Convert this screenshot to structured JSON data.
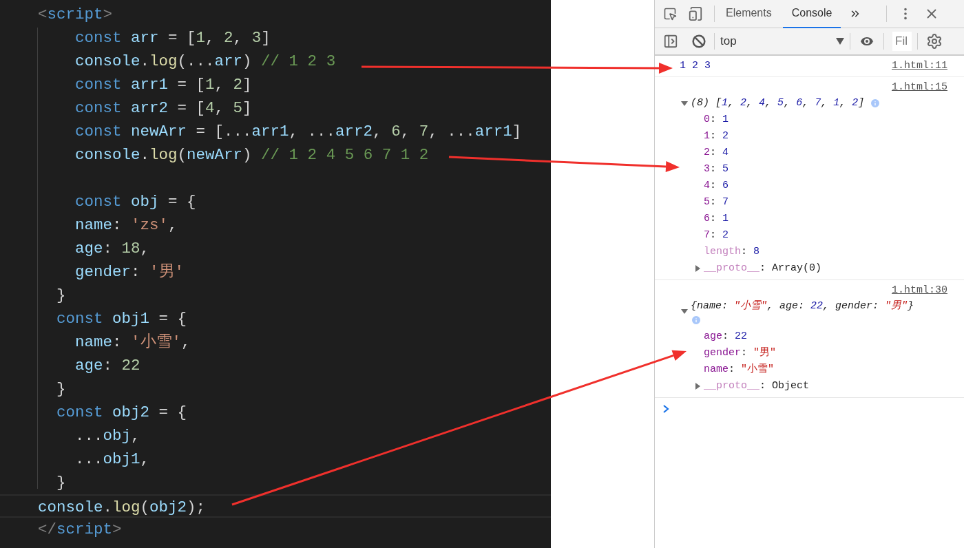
{
  "editor": {
    "lines": [
      {
        "current": false,
        "tokens": [
          {
            "kind": "bracket",
            "text": "<"
          },
          {
            "kind": "tag",
            "text": "script"
          },
          {
            "kind": "bracket",
            "text": ">"
          }
        ]
      },
      {
        "current": false,
        "tokens": [
          {
            "kind": "keyword",
            "text": "    const"
          },
          {
            "kind": "variable",
            "text": " arr"
          },
          {
            "kind": "plain",
            "text": " = ["
          },
          {
            "kind": "number",
            "text": "1"
          },
          {
            "kind": "plain",
            "text": ", "
          },
          {
            "kind": "number",
            "text": "2"
          },
          {
            "kind": "plain",
            "text": ", "
          },
          {
            "kind": "number",
            "text": "3"
          },
          {
            "kind": "plain",
            "text": "]"
          }
        ]
      },
      {
        "current": false,
        "tokens": [
          {
            "kind": "variable",
            "text": "    console"
          },
          {
            "kind": "plain",
            "text": "."
          },
          {
            "kind": "function",
            "text": "log"
          },
          {
            "kind": "plain",
            "text": "(..."
          },
          {
            "kind": "variable",
            "text": "arr"
          },
          {
            "kind": "plain",
            "text": ")"
          },
          {
            "kind": "comment",
            "text": " // 1 2 3"
          }
        ]
      },
      {
        "current": false,
        "tokens": [
          {
            "kind": "keyword",
            "text": "    const"
          },
          {
            "kind": "variable",
            "text": " arr1"
          },
          {
            "kind": "plain",
            "text": " = ["
          },
          {
            "kind": "number",
            "text": "1"
          },
          {
            "kind": "plain",
            "text": ", "
          },
          {
            "kind": "number",
            "text": "2"
          },
          {
            "kind": "plain",
            "text": "]"
          }
        ]
      },
      {
        "current": false,
        "tokens": [
          {
            "kind": "keyword",
            "text": "    const"
          },
          {
            "kind": "variable",
            "text": " arr2"
          },
          {
            "kind": "plain",
            "text": " = ["
          },
          {
            "kind": "number",
            "text": "4"
          },
          {
            "kind": "plain",
            "text": ", "
          },
          {
            "kind": "number",
            "text": "5"
          },
          {
            "kind": "plain",
            "text": "]"
          }
        ]
      },
      {
        "current": false,
        "tokens": [
          {
            "kind": "keyword",
            "text": "    const"
          },
          {
            "kind": "variable",
            "text": " newArr"
          },
          {
            "kind": "plain",
            "text": " = [..."
          },
          {
            "kind": "variable",
            "text": "arr1"
          },
          {
            "kind": "plain",
            "text": ", ..."
          },
          {
            "kind": "variable",
            "text": "arr2"
          },
          {
            "kind": "plain",
            "text": ", "
          },
          {
            "kind": "number",
            "text": "6"
          },
          {
            "kind": "plain",
            "text": ", "
          },
          {
            "kind": "number",
            "text": "7"
          },
          {
            "kind": "plain",
            "text": ", ..."
          },
          {
            "kind": "variable",
            "text": "arr1"
          },
          {
            "kind": "plain",
            "text": "]"
          }
        ]
      },
      {
        "current": false,
        "tokens": [
          {
            "kind": "variable",
            "text": "    console"
          },
          {
            "kind": "plain",
            "text": "."
          },
          {
            "kind": "function",
            "text": "log"
          },
          {
            "kind": "plain",
            "text": "("
          },
          {
            "kind": "variable",
            "text": "newArr"
          },
          {
            "kind": "plain",
            "text": ")"
          },
          {
            "kind": "comment",
            "text": " // 1 2 4 5 6 7 1 2"
          }
        ]
      },
      {
        "current": false
      },
      {
        "current": false,
        "tokens": [
          {
            "kind": "keyword",
            "text": "    const"
          },
          {
            "kind": "variable",
            "text": " obj"
          },
          {
            "kind": "plain",
            "text": " = {"
          }
        ]
      },
      {
        "current": false,
        "tokens": [
          {
            "kind": "variable",
            "text": "    name"
          },
          {
            "kind": "plain",
            "text": ": "
          },
          {
            "kind": "string",
            "text": "'zs'"
          },
          {
            "kind": "plain",
            "text": ","
          }
        ]
      },
      {
        "current": false,
        "tokens": [
          {
            "kind": "variable",
            "text": "    age"
          },
          {
            "kind": "plain",
            "text": ": "
          },
          {
            "kind": "number",
            "text": "18"
          },
          {
            "kind": "plain",
            "text": ","
          }
        ]
      },
      {
        "current": false,
        "tokens": [
          {
            "kind": "variable",
            "text": "    gender"
          },
          {
            "kind": "plain",
            "text": ": "
          },
          {
            "kind": "string",
            "text": "'男'"
          }
        ]
      },
      {
        "current": false,
        "tokens": [
          {
            "kind": "plain",
            "text": "  }"
          }
        ]
      },
      {
        "current": false,
        "tokens": [
          {
            "kind": "keyword",
            "text": "  const"
          },
          {
            "kind": "variable",
            "text": " obj1"
          },
          {
            "kind": "plain",
            "text": " = {"
          }
        ]
      },
      {
        "current": false,
        "tokens": [
          {
            "kind": "variable",
            "text": "    name"
          },
          {
            "kind": "plain",
            "text": ": "
          },
          {
            "kind": "string",
            "text": "'小雪'"
          },
          {
            "kind": "plain",
            "text": ","
          }
        ]
      },
      {
        "current": false,
        "tokens": [
          {
            "kind": "variable",
            "text": "    age"
          },
          {
            "kind": "plain",
            "text": ": "
          },
          {
            "kind": "number",
            "text": "22"
          }
        ]
      },
      {
        "current": false,
        "tokens": [
          {
            "kind": "plain",
            "text": "  }"
          }
        ]
      },
      {
        "current": false,
        "tokens": [
          {
            "kind": "keyword",
            "text": "  const"
          },
          {
            "kind": "variable",
            "text": " obj2"
          },
          {
            "kind": "plain",
            "text": " = {"
          }
        ]
      },
      {
        "current": false,
        "tokens": [
          {
            "kind": "plain",
            "text": "    ..."
          },
          {
            "kind": "variable",
            "text": "obj"
          },
          {
            "kind": "plain",
            "text": ","
          }
        ]
      },
      {
        "current": false,
        "tokens": [
          {
            "kind": "plain",
            "text": "    ..."
          },
          {
            "kind": "variable",
            "text": "obj1"
          },
          {
            "kind": "plain",
            "text": ","
          }
        ]
      },
      {
        "current": false,
        "tokens": [
          {
            "kind": "plain",
            "text": "  }"
          }
        ]
      },
      {
        "current": true,
        "tokens": [
          {
            "kind": "variable",
            "text": "console"
          },
          {
            "kind": "plain",
            "text": "."
          },
          {
            "kind": "function",
            "text": "log"
          },
          {
            "kind": "plain",
            "text": "("
          },
          {
            "kind": "variable",
            "text": "obj2"
          },
          {
            "kind": "plain",
            "text": ");"
          }
        ]
      },
      {
        "current": false,
        "tokens": [
          {
            "kind": "bracket",
            "text": "</"
          },
          {
            "kind": "tag",
            "text": "script"
          },
          {
            "kind": "bracket",
            "text": ">"
          }
        ]
      }
    ]
  },
  "devtools": {
    "tabs": [
      {
        "label": "Elements",
        "selected": false
      },
      {
        "label": "Console",
        "selected": true
      }
    ],
    "context": "top",
    "filter": {
      "placeholder": "Fil"
    },
    "messages": [
      {
        "kind": "values",
        "source": "1.html:11",
        "text": "1 2 3"
      },
      {
        "kind": "array",
        "source": "1.html:15",
        "expanded": true,
        "summary": [
          {
            "kind": "punct",
            "text": "(8) ["
          },
          {
            "kind": "number",
            "text": "1"
          },
          {
            "kind": "punct",
            "text": ", "
          },
          {
            "kind": "number",
            "text": "2"
          },
          {
            "kind": "punct",
            "text": ", "
          },
          {
            "kind": "number",
            "text": "4"
          },
          {
            "kind": "punct",
            "text": ", "
          },
          {
            "kind": "number",
            "text": "5"
          },
          {
            "kind": "punct",
            "text": ", "
          },
          {
            "kind": "number",
            "text": "6"
          },
          {
            "kind": "punct",
            "text": ", "
          },
          {
            "kind": "number",
            "text": "7"
          },
          {
            "kind": "punct",
            "text": ", "
          },
          {
            "kind": "number",
            "text": "1"
          },
          {
            "kind": "punct",
            "text": ", "
          },
          {
            "kind": "number",
            "text": "2"
          },
          {
            "kind": "punct",
            "text": "]"
          }
        ],
        "entries": [
          {
            "key": "0",
            "sep": ":",
            "value": "1",
            "kind": "number",
            "enumerable": true
          },
          {
            "key": "1",
            "sep": ":",
            "value": "2",
            "kind": "number",
            "enumerable": true
          },
          {
            "key": "2",
            "sep": ":",
            "value": "4",
            "kind": "number",
            "enumerable": true
          },
          {
            "key": "3",
            "sep": ":",
            "value": "5",
            "kind": "number",
            "enumerable": true
          },
          {
            "key": "4",
            "sep": ":",
            "value": "6",
            "kind": "number",
            "enumerable": true
          },
          {
            "key": "5",
            "sep": ":",
            "value": "7",
            "kind": "number",
            "enumerable": true
          },
          {
            "key": "6",
            "sep": ":",
            "value": "1",
            "kind": "number",
            "enumerable": true
          },
          {
            "key": "7",
            "sep": ":",
            "value": "2",
            "kind": "number",
            "enumerable": true
          },
          {
            "key": "length",
            "sep": ":",
            "value": "8",
            "kind": "number",
            "enumerable": false
          }
        ],
        "proto": {
          "key": "__proto__",
          "sep": ":",
          "value": "Array(0)",
          "expanded": false
        }
      },
      {
        "kind": "object",
        "source": "1.html:30",
        "expanded": true,
        "summary": [
          {
            "kind": "punct",
            "text": "{name: "
          },
          {
            "kind": "string",
            "text": "\"小雪\""
          },
          {
            "kind": "punct",
            "text": ", age: "
          },
          {
            "kind": "number",
            "text": "22"
          },
          {
            "kind": "punct",
            "text": ", gender: "
          },
          {
            "kind": "string",
            "text": "\"男\""
          },
          {
            "kind": "punct",
            "text": "}"
          }
        ],
        "entries": [
          {
            "key": "age",
            "sep": ":",
            "value": "22",
            "kind": "number",
            "enumerable": true
          },
          {
            "key": "gender",
            "sep": ":",
            "value": "\"男\"",
            "kind": "string",
            "enumerable": true
          },
          {
            "key": "name",
            "sep": ":",
            "value": "\"小雪\"",
            "kind": "string",
            "enumerable": true
          }
        ],
        "proto": {
          "key": "__proto__",
          "sep": ":",
          "value": "Object",
          "expanded": false
        }
      }
    ]
  }
}
